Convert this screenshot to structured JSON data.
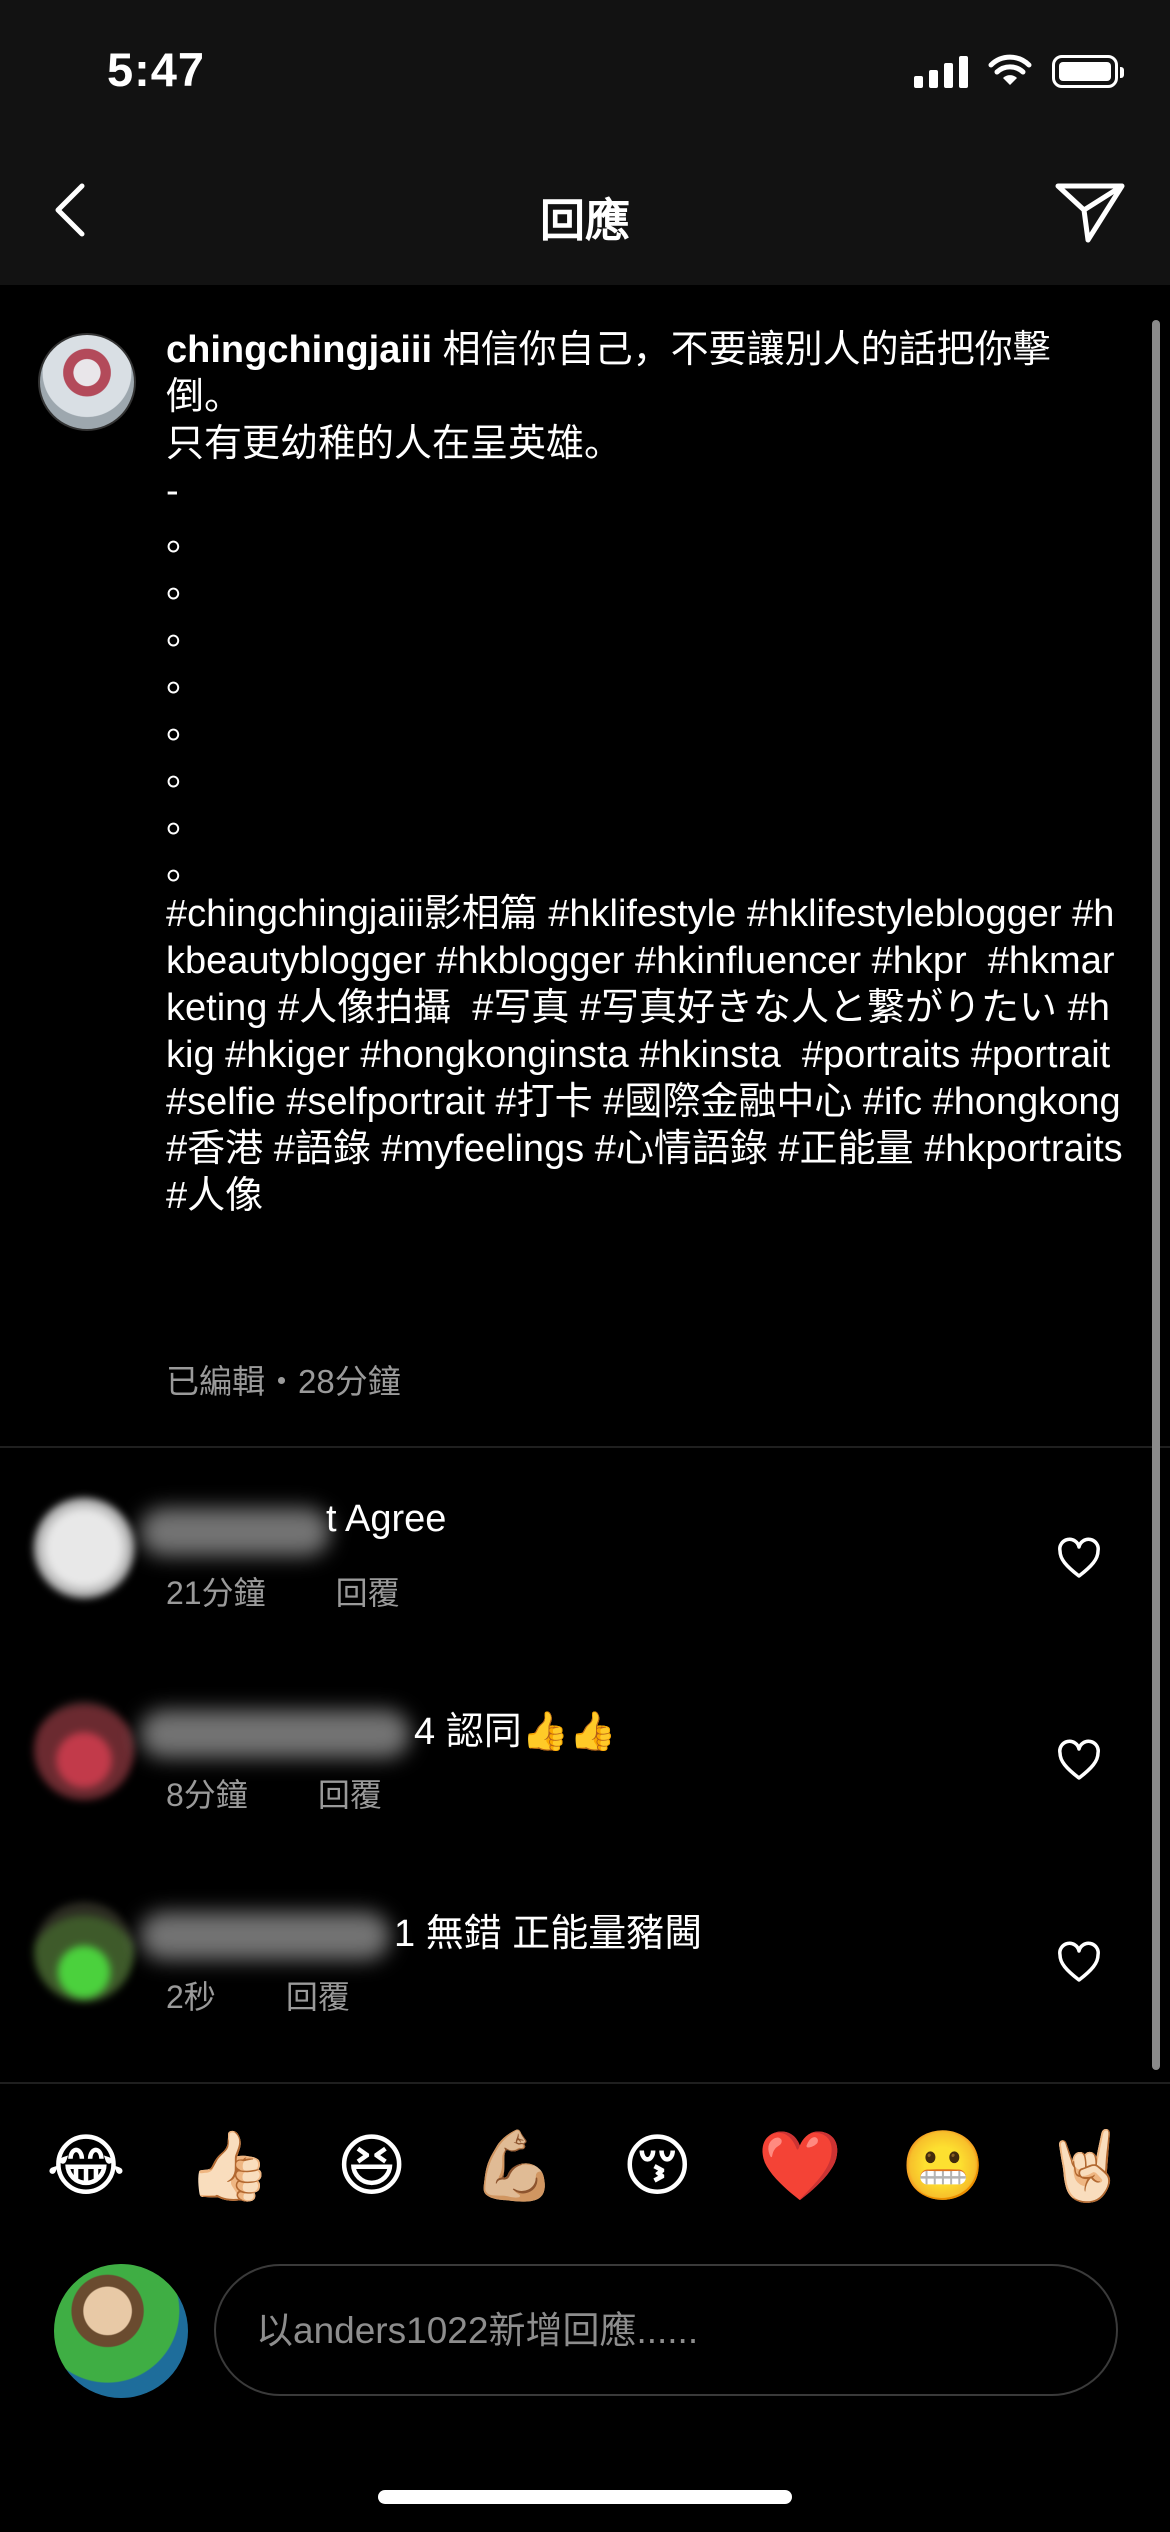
{
  "status_bar": {
    "time": "5:47"
  },
  "header": {
    "title": "回應"
  },
  "caption": {
    "username": "chingchingjaiii",
    "text": " 相信你自己，不要讓別人的話把你擊倒。\n只有更幼稚的人在呈英雄。\n-\n。\n。\n。\n。\n。\n。\n。\n。\n#chingchingjaiii影相篇 #hklifestyle #hklifestyleblogger #hkbeautyblogger #hkblogger #hkinfluencer #hkpr  #hkmarketing #人像拍攝  #写真 #写真好きな人と繋がりたい #hkig #hkiger #hongkonginsta #hkinsta  #portraits #portrait #selfie #selfportrait #打卡 #國際金融中心 #ifc #hongkong #香港 #語錄 #myfeelings #心情語錄 #正能量 #hkportraits #人像",
    "meta": "已編輯・28分鐘"
  },
  "comments": [
    {
      "text": "t Agree",
      "time": "21分鐘",
      "reply_label": "回覆"
    },
    {
      "text": "4 認同👍👍",
      "time": "8分鐘",
      "reply_label": "回覆"
    },
    {
      "text": "1 無錯 正能量豬閪",
      "time": "2秒",
      "reply_label": "回覆"
    }
  ],
  "quick_reactions": [
    "😂",
    "👍🏻",
    "😆",
    "💪🏼",
    "😚",
    "❤️",
    "😬",
    "🤘🏻"
  ],
  "comment_input": {
    "placeholder": "以anders1022新增回應......"
  },
  "icons": [
    "back-chevron-icon",
    "send-icon",
    "heart-icon",
    "signal-icon",
    "wifi-icon",
    "battery-icon"
  ]
}
